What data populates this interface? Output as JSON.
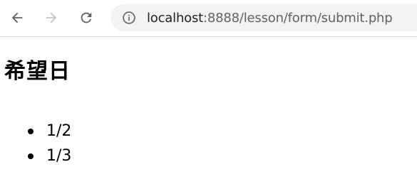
{
  "browser": {
    "url_host": "localhost",
    "url_rest": ":8888/lesson/form/submit.php",
    "colors": {
      "toolbar_bg": "#ffffff",
      "omnibox_bg": "#f1f3f4",
      "icon_active": "#5f6368",
      "icon_disabled": "#c4c7ca"
    },
    "icons": {
      "back": "back-arrow-icon",
      "forward": "forward-arrow-icon",
      "reload": "reload-icon",
      "info": "info-icon"
    }
  },
  "page": {
    "heading": "希望日",
    "items": [
      "1/2",
      "1/3"
    ]
  }
}
